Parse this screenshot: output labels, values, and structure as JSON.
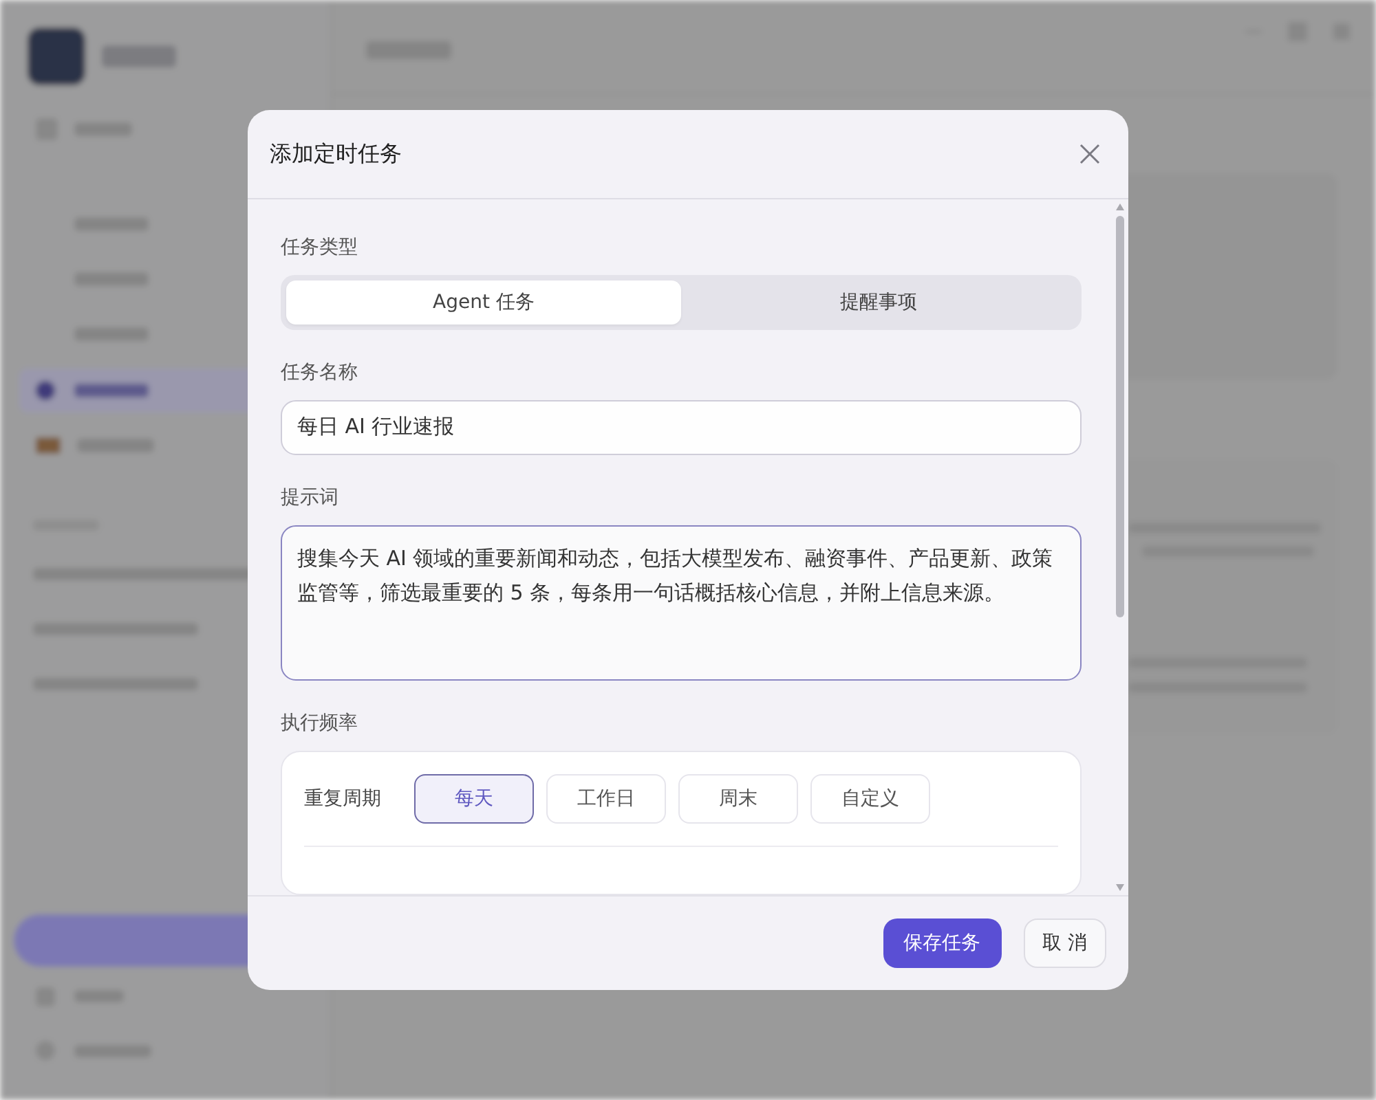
{
  "dialog": {
    "title": "添加定时任务",
    "task_type": {
      "label": "任务类型",
      "options": [
        {
          "label": "Agent 任务",
          "selected": true
        },
        {
          "label": "提醒事项",
          "selected": false
        }
      ]
    },
    "task_name": {
      "label": "任务名称",
      "value": "每日 AI 行业速报"
    },
    "prompt": {
      "label": "提示词",
      "value": "搜集今天 AI 领域的重要新闻和动态，包括大模型发布、融资事件、产品更新、政策监管等，筛选最重要的 5 条，每条用一句话概括核心信息，并附上信息来源。"
    },
    "frequency": {
      "label": "执行频率",
      "repeat_label": "重复周期",
      "options": [
        {
          "label": "每天",
          "selected": true
        },
        {
          "label": "工作日",
          "selected": false
        },
        {
          "label": "周末",
          "selected": false
        },
        {
          "label": "自定义",
          "selected": false
        }
      ]
    },
    "buttons": [
      {
        "label": "保存任务",
        "kind": "primary"
      },
      {
        "label": "取 消",
        "kind": "secondary"
      }
    ]
  }
}
